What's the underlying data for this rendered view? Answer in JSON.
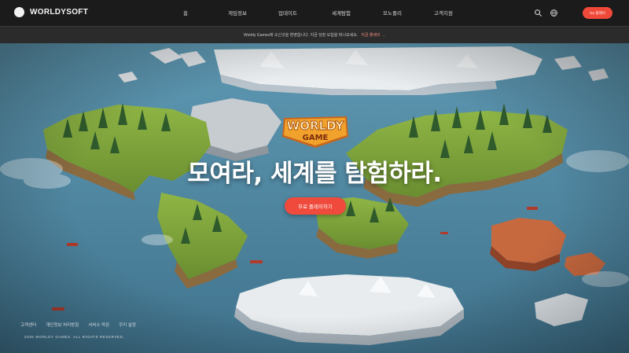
{
  "brand": {
    "name": "WORLDYSOFT"
  },
  "nav": {
    "items": [
      {
        "label": "홈"
      },
      {
        "label": "게임정보"
      },
      {
        "label": "업데이트"
      },
      {
        "label": "세계탐험"
      },
      {
        "label": "모노폴리"
      },
      {
        "label": "고객지원"
      }
    ],
    "search_icon": "search-icon",
    "globe_icon": "globe-icon",
    "cta_label": "Go 플레이"
  },
  "notice": {
    "text": "Worldy Games에 오신것을 환영합니다. 지금 당장 모험을 떠나보세요.",
    "link_label": "지금 플레이 →"
  },
  "hero": {
    "logo_line1": "WORLDY",
    "logo_line2": "GAME",
    "headline": "모여라, 세계를 탐험하라.",
    "play_label": "무료 플레이하기"
  },
  "footer": {
    "links": [
      "고객센터",
      "개인정보 처리방침",
      "서비스 약관",
      "쿠키 설정"
    ],
    "copyright": "2025 WORLDY GAMES. ALL RIGHTS RESERVED."
  },
  "colors": {
    "accent": "#ef4a3b",
    "nav_bg": "#1b1b1b",
    "ocean": "#4f87a0"
  }
}
